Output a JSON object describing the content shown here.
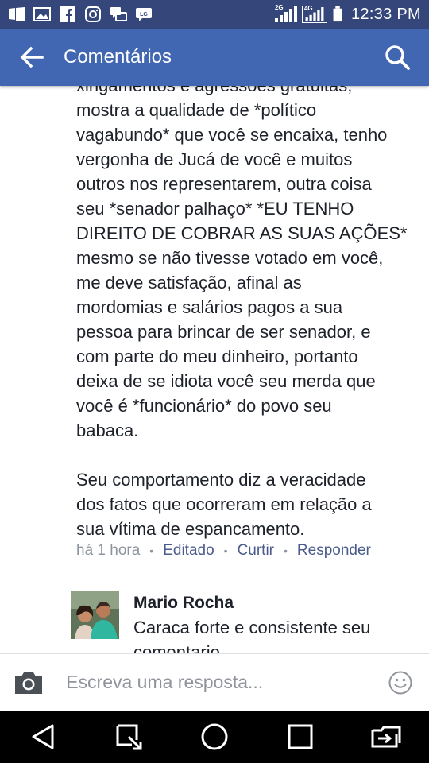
{
  "status_bar": {
    "time": "12:33 PM",
    "signal_1_tag": "2G",
    "signal_2_tag": "4G",
    "notification_icons": [
      "windows-icon",
      "gallery-icon",
      "facebook-icon",
      "instagram-icon",
      "messenger-icon",
      "app-icon"
    ]
  },
  "app_bar": {
    "title": "Comentários",
    "color": "#4267b2"
  },
  "comment": {
    "text": "xingamentos e agressões gratuitas,\nmostra a qualidade de *político\nvagabundo* que você se encaixa, tenho\nvergonha de Jucá de você e muitos\noutros nos representarem, outra coisa\nseu *senador palhaço* *EU TENHO\nDIREITO DE COBRAR AS SUAS AÇÕES*\nmesmo se não tivesse votado em você,\nme deve satisfação, afinal as\nmordomias e salários pagos a sua\npessoa para brincar de ser senador, e\ncom  parte do meu dinheiro, portanto\ndeixa de se idiota você seu merda que\nvocê é *funcionário* do povo seu\nbabaca.\n\nSeu comportamento diz a veracidade\ndos fatos que ocorreram em relação a\nsua vítima de espancamento.",
    "time": "há 1 hora",
    "edited_label": "Editado",
    "like_label": "Curtir",
    "reply_label": "Responder"
  },
  "reply": {
    "author": "Mario Rocha",
    "text": "Caraca forte e consistente seu\ncomentario"
  },
  "composer": {
    "placeholder": "Escreva uma resposta..."
  }
}
